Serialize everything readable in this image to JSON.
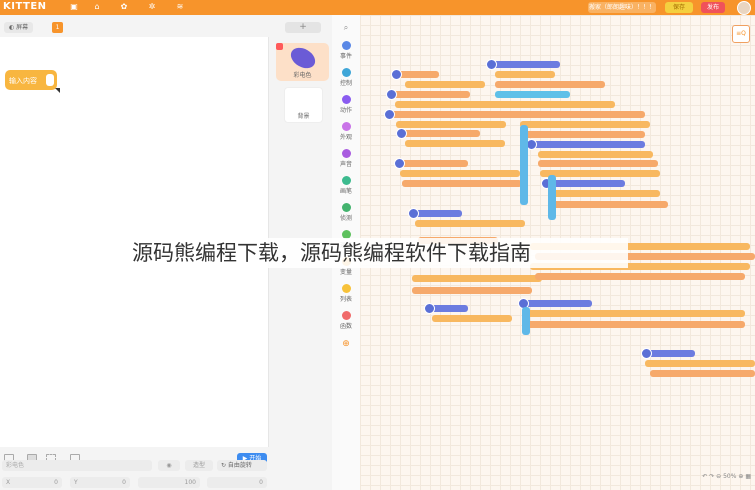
{
  "app": {
    "logo": "KITTEN",
    "top_icons": [
      "save-icon",
      "bag-icon",
      "palette-icon",
      "gear-icon",
      "wifi-icon"
    ],
    "project_name": "搬家（郎朗趣味）！！！",
    "save_label": "保存",
    "publish_label": "发布",
    "brand_color": "#f7942b"
  },
  "stage_panel": {
    "scene_tab": "◐ 屏幕",
    "scene_count": "1",
    "add_label": "+",
    "speech_text": "输入内容",
    "sprites": [
      {
        "label": "彩电色"
      }
    ],
    "background_label": "背景",
    "start_label": "▶ 开始",
    "sprite_name_value": "彩电色",
    "costume_label": "造型",
    "rotate_label": "↻ 自由旋转",
    "x_label": "X",
    "x_value": "0",
    "y_label": "Y",
    "y_value": "0",
    "size_value": "100",
    "rotation_value": "0"
  },
  "categories": [
    {
      "label": "事件",
      "color": "#5a88e6"
    },
    {
      "label": "控制",
      "color": "#3fa6d8"
    },
    {
      "label": "动作",
      "color": "#8a5cf0"
    },
    {
      "label": "外观",
      "color": "#c974e8"
    },
    {
      "label": "声音",
      "color": "#a95ce0"
    },
    {
      "label": "画笔",
      "color": "#3dbb8f"
    },
    {
      "label": "侦测",
      "color": "#43b36e"
    },
    {
      "label": "运算",
      "color": "#5ec15e"
    },
    {
      "label": "变量",
      "color": "#f2a93b"
    },
    {
      "label": "列表",
      "color": "#f7c23a"
    },
    {
      "label": "函数",
      "color": "#f06a6a"
    }
  ],
  "workspace": {
    "zoom": "50%",
    "corner_label": "≡Q"
  },
  "overlay_title": "源码熊编程下载，源码熊编程软件下载指南"
}
